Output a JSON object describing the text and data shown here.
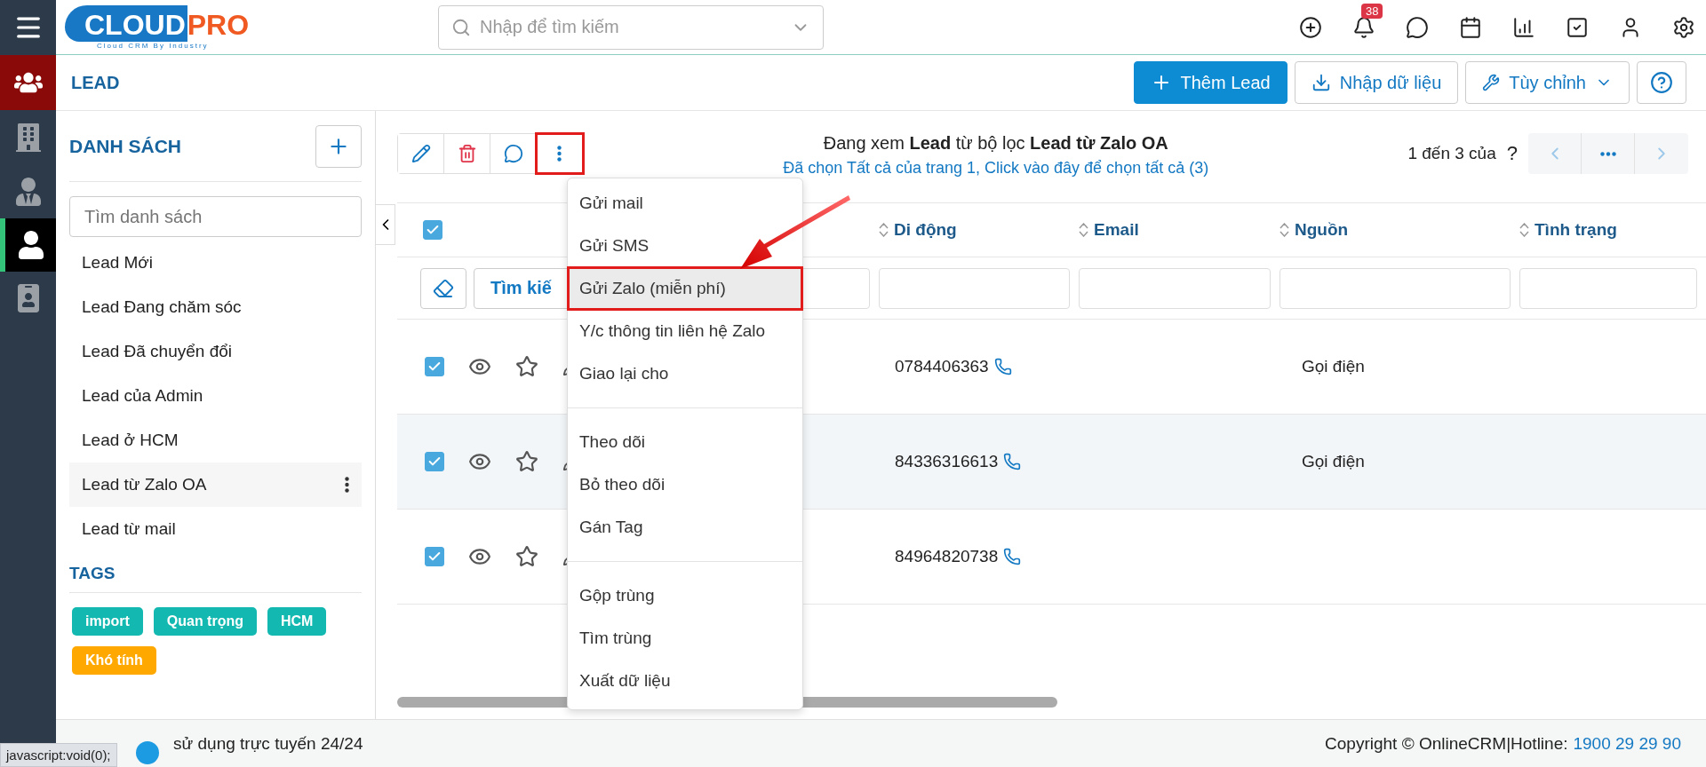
{
  "rail": {
    "items": [
      {
        "kind": "people",
        "selected": true
      },
      {
        "kind": "building",
        "selected": false
      },
      {
        "kind": "agent",
        "selected": false
      },
      {
        "kind": "person",
        "selected": true
      },
      {
        "kind": "document",
        "selected": false
      }
    ]
  },
  "logo": {
    "part_1": "CLOUD",
    "part_2": "PRO",
    "tagline": "Cloud CRM By Industry"
  },
  "search": {
    "placeholder": "Nhập để tìm kiếm"
  },
  "header_icons": [
    {
      "kind": "add"
    },
    {
      "kind": "bell",
      "badge": "38"
    },
    {
      "kind": "chat"
    },
    {
      "kind": "calendar"
    },
    {
      "kind": "chart"
    },
    {
      "kind": "task"
    },
    {
      "kind": "user"
    },
    {
      "kind": "settings"
    }
  ],
  "page_header": {
    "title": "LEAD",
    "buttons": [
      {
        "kind": "primary",
        "label": "Thêm Lead"
      },
      {
        "kind": "import",
        "label": "Nhập dữ liệu"
      },
      {
        "kind": "dropdown",
        "label": "Tùy chỉnh"
      },
      {
        "kind": "help"
      }
    ]
  },
  "sidebar": {
    "title": "DANH SÁCH",
    "search_placeholder": "Tìm danh sách",
    "items": [
      {
        "label": "Lead Mới",
        "selected": false
      },
      {
        "label": "Lead Đang chăm sóc",
        "selected": false
      },
      {
        "label": "Lead Đã chuyển đổi",
        "selected": false
      },
      {
        "label": "Lead của Admin",
        "selected": false
      },
      {
        "label": "Lead ở HCM",
        "selected": false
      },
      {
        "label": "Lead từ Zalo OA",
        "selected": true
      },
      {
        "label": "Lead từ mail",
        "selected": false
      }
    ],
    "tags_title": "TAGS",
    "tags": [
      {
        "label": "import",
        "color": "#13b9b1"
      },
      {
        "label": "Quan trọng",
        "color": "#13b9b1"
      },
      {
        "label": "HCM",
        "color": "#13b9b1"
      },
      {
        "label": "Khó tính",
        "color": "#ffa800"
      }
    ]
  },
  "toolbar": {
    "buttons": [
      {
        "kind": "edit",
        "annotated": false
      },
      {
        "kind": "delete",
        "annotated": false
      },
      {
        "kind": "comment",
        "annotated": false
      },
      {
        "kind": "more",
        "annotated": true
      }
    ]
  },
  "view_info": {
    "text": "Đang xem **Lead** từ bộ lọc **Lead từ Zalo OA**",
    "select_link": "Đã chọn Tất cả của trang 1, Click vào đây để chọn tất cả (3)"
  },
  "pager": {
    "range": "1 đến 3 của",
    "total": "?"
  },
  "table": {
    "select_all": true,
    "columns": [
      {
        "label": "Di động"
      },
      {
        "label": "Email"
      },
      {
        "label": "Nguồn"
      },
      {
        "label": "Tình trạng"
      }
    ],
    "filter_button": "Tìm kiế",
    "rows": [
      {
        "checked": true,
        "selected": false,
        "phone": "0784406363",
        "source": "Gọi điện"
      },
      {
        "checked": true,
        "selected": true,
        "phone": "84336316613",
        "source": "Gọi điện"
      },
      {
        "checked": true,
        "selected": false,
        "phone": "84964820738"
      }
    ]
  },
  "action_menu": {
    "groups": [
      [
        {
          "label": "Gửi mail",
          "selected": false,
          "annotated": false
        },
        {
          "label": "Gửi SMS",
          "selected": false,
          "annotated": false
        },
        {
          "label": "Gửi Zalo (miễn phí)",
          "selected": true,
          "annotated": true
        },
        {
          "label": "Y/c thông tin liên hệ Zalo",
          "selected": false,
          "annotated": false
        },
        {
          "label": "Giao lại cho",
          "selected": false,
          "annotated": false
        }
      ],
      [
        {
          "label": "Theo dõi",
          "selected": false,
          "annotated": false
        },
        {
          "label": "Bỏ theo dõi",
          "selected": false,
          "annotated": false
        },
        {
          "label": "Gán Tag",
          "selected": false,
          "annotated": false
        }
      ],
      [
        {
          "label": "Gộp trùng",
          "selected": false,
          "annotated": false
        },
        {
          "label": "Tìm trùng",
          "selected": false,
          "annotated": false
        },
        {
          "label": "Xuất dữ liệu",
          "selected": false,
          "annotated": false
        }
      ]
    ]
  },
  "footer": {
    "support": "sử dụng trực tuyến 24/24",
    "copyright": "Copyright © OnlineCRM|Hotline:",
    "hotline": "1900 29 29 90",
    "status_tooltip": "javascript:void(0);"
  }
}
